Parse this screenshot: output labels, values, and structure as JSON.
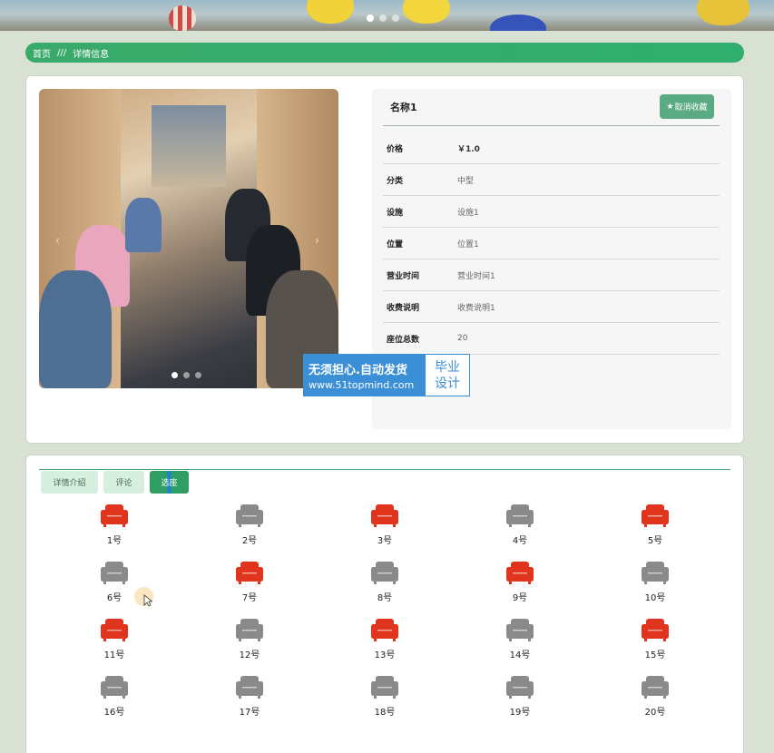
{
  "breadcrumb": {
    "home": "首页",
    "separator": "///",
    "current": "详情信息"
  },
  "detail": {
    "title": "名称1",
    "favorite_button": "取消收藏",
    "favorite_icon": "star-icon",
    "rows": [
      {
        "label": "价格",
        "value": "￥1.0"
      },
      {
        "label": "分类",
        "value": "中型"
      },
      {
        "label": "设施",
        "value": "设施1"
      },
      {
        "label": "位置",
        "value": "位置1"
      },
      {
        "label": "营业时间",
        "value": "营业时间1"
      },
      {
        "label": "收费说明",
        "value": "收费说明1"
      },
      {
        "label": "座位总数",
        "value": "20"
      }
    ]
  },
  "watermark": {
    "line1": "无须担心.自动发货",
    "line2": "www.51topmind.com",
    "right1": "毕业",
    "right2": "设计"
  },
  "tabs": [
    {
      "label": "详情介绍"
    },
    {
      "label": "评论"
    },
    {
      "label": "选座",
      "active": true
    }
  ],
  "seats": [
    {
      "label": "1号",
      "taken": true
    },
    {
      "label": "2号",
      "taken": false
    },
    {
      "label": "3号",
      "taken": true
    },
    {
      "label": "4号",
      "taken": false
    },
    {
      "label": "5号",
      "taken": true
    },
    {
      "label": "6号",
      "taken": false
    },
    {
      "label": "7号",
      "taken": true
    },
    {
      "label": "8号",
      "taken": false
    },
    {
      "label": "9号",
      "taken": true
    },
    {
      "label": "10号",
      "taken": false
    },
    {
      "label": "11号",
      "taken": true
    },
    {
      "label": "12号",
      "taken": false
    },
    {
      "label": "13号",
      "taken": true
    },
    {
      "label": "14号",
      "taken": false
    },
    {
      "label": "15号",
      "taken": true
    },
    {
      "label": "16号",
      "taken": false
    },
    {
      "label": "17号",
      "taken": false
    },
    {
      "label": "18号",
      "taken": false
    },
    {
      "label": "19号",
      "taken": false
    },
    {
      "label": "20号",
      "taken": false
    }
  ],
  "colors": {
    "seat_taken": "#e0341c",
    "seat_free": "#8a8a8a",
    "accent": "#34a86a"
  }
}
